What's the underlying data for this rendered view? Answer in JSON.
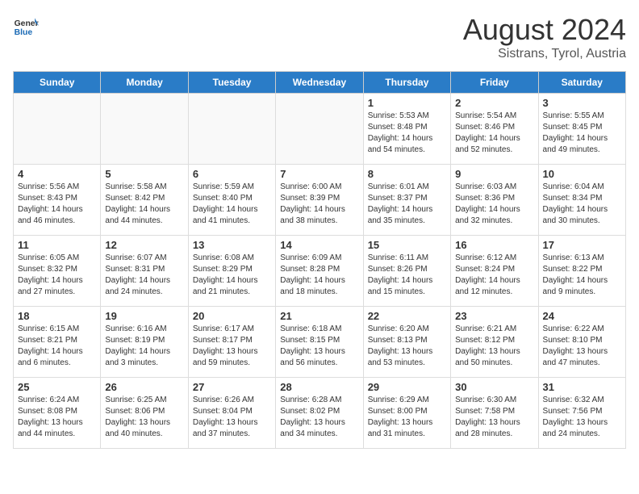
{
  "header": {
    "logo_line1": "General",
    "logo_line2": "Blue",
    "month": "August 2024",
    "location": "Sistrans, Tyrol, Austria"
  },
  "weekdays": [
    "Sunday",
    "Monday",
    "Tuesday",
    "Wednesday",
    "Thursday",
    "Friday",
    "Saturday"
  ],
  "weeks": [
    [
      {
        "day": "",
        "info": ""
      },
      {
        "day": "",
        "info": ""
      },
      {
        "day": "",
        "info": ""
      },
      {
        "day": "",
        "info": ""
      },
      {
        "day": "1",
        "info": "Sunrise: 5:53 AM\nSunset: 8:48 PM\nDaylight: 14 hours\nand 54 minutes."
      },
      {
        "day": "2",
        "info": "Sunrise: 5:54 AM\nSunset: 8:46 PM\nDaylight: 14 hours\nand 52 minutes."
      },
      {
        "day": "3",
        "info": "Sunrise: 5:55 AM\nSunset: 8:45 PM\nDaylight: 14 hours\nand 49 minutes."
      }
    ],
    [
      {
        "day": "4",
        "info": "Sunrise: 5:56 AM\nSunset: 8:43 PM\nDaylight: 14 hours\nand 46 minutes."
      },
      {
        "day": "5",
        "info": "Sunrise: 5:58 AM\nSunset: 8:42 PM\nDaylight: 14 hours\nand 44 minutes."
      },
      {
        "day": "6",
        "info": "Sunrise: 5:59 AM\nSunset: 8:40 PM\nDaylight: 14 hours\nand 41 minutes."
      },
      {
        "day": "7",
        "info": "Sunrise: 6:00 AM\nSunset: 8:39 PM\nDaylight: 14 hours\nand 38 minutes."
      },
      {
        "day": "8",
        "info": "Sunrise: 6:01 AM\nSunset: 8:37 PM\nDaylight: 14 hours\nand 35 minutes."
      },
      {
        "day": "9",
        "info": "Sunrise: 6:03 AM\nSunset: 8:36 PM\nDaylight: 14 hours\nand 32 minutes."
      },
      {
        "day": "10",
        "info": "Sunrise: 6:04 AM\nSunset: 8:34 PM\nDaylight: 14 hours\nand 30 minutes."
      }
    ],
    [
      {
        "day": "11",
        "info": "Sunrise: 6:05 AM\nSunset: 8:32 PM\nDaylight: 14 hours\nand 27 minutes."
      },
      {
        "day": "12",
        "info": "Sunrise: 6:07 AM\nSunset: 8:31 PM\nDaylight: 14 hours\nand 24 minutes."
      },
      {
        "day": "13",
        "info": "Sunrise: 6:08 AM\nSunset: 8:29 PM\nDaylight: 14 hours\nand 21 minutes."
      },
      {
        "day": "14",
        "info": "Sunrise: 6:09 AM\nSunset: 8:28 PM\nDaylight: 14 hours\nand 18 minutes."
      },
      {
        "day": "15",
        "info": "Sunrise: 6:11 AM\nSunset: 8:26 PM\nDaylight: 14 hours\nand 15 minutes."
      },
      {
        "day": "16",
        "info": "Sunrise: 6:12 AM\nSunset: 8:24 PM\nDaylight: 14 hours\nand 12 minutes."
      },
      {
        "day": "17",
        "info": "Sunrise: 6:13 AM\nSunset: 8:22 PM\nDaylight: 14 hours\nand 9 minutes."
      }
    ],
    [
      {
        "day": "18",
        "info": "Sunrise: 6:15 AM\nSunset: 8:21 PM\nDaylight: 14 hours\nand 6 minutes."
      },
      {
        "day": "19",
        "info": "Sunrise: 6:16 AM\nSunset: 8:19 PM\nDaylight: 14 hours\nand 3 minutes."
      },
      {
        "day": "20",
        "info": "Sunrise: 6:17 AM\nSunset: 8:17 PM\nDaylight: 13 hours\nand 59 minutes."
      },
      {
        "day": "21",
        "info": "Sunrise: 6:18 AM\nSunset: 8:15 PM\nDaylight: 13 hours\nand 56 minutes."
      },
      {
        "day": "22",
        "info": "Sunrise: 6:20 AM\nSunset: 8:13 PM\nDaylight: 13 hours\nand 53 minutes."
      },
      {
        "day": "23",
        "info": "Sunrise: 6:21 AM\nSunset: 8:12 PM\nDaylight: 13 hours\nand 50 minutes."
      },
      {
        "day": "24",
        "info": "Sunrise: 6:22 AM\nSunset: 8:10 PM\nDaylight: 13 hours\nand 47 minutes."
      }
    ],
    [
      {
        "day": "25",
        "info": "Sunrise: 6:24 AM\nSunset: 8:08 PM\nDaylight: 13 hours\nand 44 minutes."
      },
      {
        "day": "26",
        "info": "Sunrise: 6:25 AM\nSunset: 8:06 PM\nDaylight: 13 hours\nand 40 minutes."
      },
      {
        "day": "27",
        "info": "Sunrise: 6:26 AM\nSunset: 8:04 PM\nDaylight: 13 hours\nand 37 minutes."
      },
      {
        "day": "28",
        "info": "Sunrise: 6:28 AM\nSunset: 8:02 PM\nDaylight: 13 hours\nand 34 minutes."
      },
      {
        "day": "29",
        "info": "Sunrise: 6:29 AM\nSunset: 8:00 PM\nDaylight: 13 hours\nand 31 minutes."
      },
      {
        "day": "30",
        "info": "Sunrise: 6:30 AM\nSunset: 7:58 PM\nDaylight: 13 hours\nand 28 minutes."
      },
      {
        "day": "31",
        "info": "Sunrise: 6:32 AM\nSunset: 7:56 PM\nDaylight: 13 hours\nand 24 minutes."
      }
    ]
  ]
}
